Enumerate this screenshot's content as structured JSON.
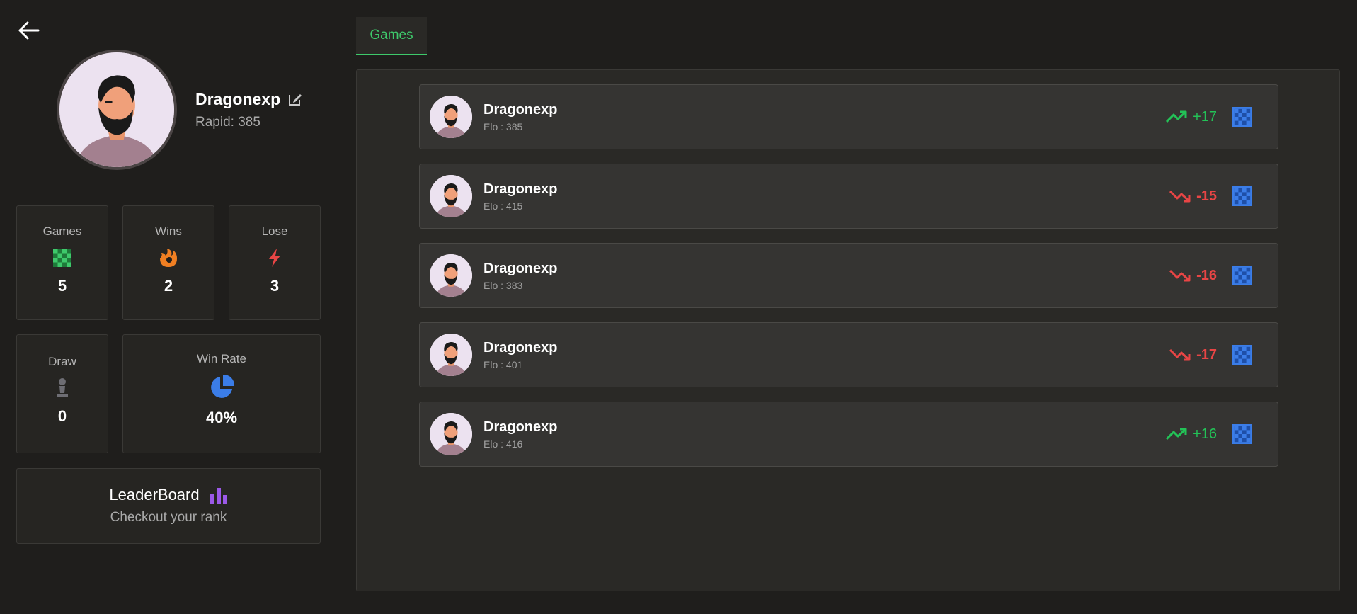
{
  "profile": {
    "username": "Dragonexp",
    "rating": "Rapid: 385"
  },
  "stats": {
    "games": {
      "label": "Games",
      "value": "5"
    },
    "wins": {
      "label": "Wins",
      "value": "2"
    },
    "lose": {
      "label": "Lose",
      "value": "3"
    },
    "draw": {
      "label": "Draw",
      "value": "0"
    },
    "win_rate": {
      "label": "Win Rate",
      "value": "40%"
    }
  },
  "leaderboard": {
    "title": "LeaderBoard",
    "subtitle": "Checkout your rank"
  },
  "tabs": [
    "Games"
  ],
  "games": [
    {
      "name": "Dragonexp",
      "elo": "Elo : 385",
      "change": "+17",
      "direction": "up"
    },
    {
      "name": "Dragonexp",
      "elo": "Elo : 415",
      "change": "-15",
      "direction": "down"
    },
    {
      "name": "Dragonexp",
      "elo": "Elo : 383",
      "change": "-16",
      "direction": "down"
    },
    {
      "name": "Dragonexp",
      "elo": "Elo : 401",
      "change": "-17",
      "direction": "down"
    },
    {
      "name": "Dragonexp",
      "elo": "Elo : 416",
      "change": "+16",
      "direction": "up"
    }
  ],
  "colors": {
    "background": "#1f1e1c",
    "card": "#262522",
    "accent_green": "#3ec96b",
    "gain": "#23c257",
    "loss": "#e84545",
    "board_blue": "#3b7de8",
    "leaderboard_purple": "#9b59e8",
    "wins_orange": "#f07f22"
  },
  "icons": {
    "back": "arrow-left-icon",
    "edit": "edit-icon",
    "games": "chessboard-icon",
    "wins": "fire-icon",
    "lose": "lightning-icon",
    "draw": "pawn-icon",
    "win_rate": "pie-chart-icon",
    "leaderboard": "bar-chart-icon",
    "trend_up": "trend-up-icon",
    "trend_down": "trend-down-icon",
    "board": "chessboard-icon"
  }
}
